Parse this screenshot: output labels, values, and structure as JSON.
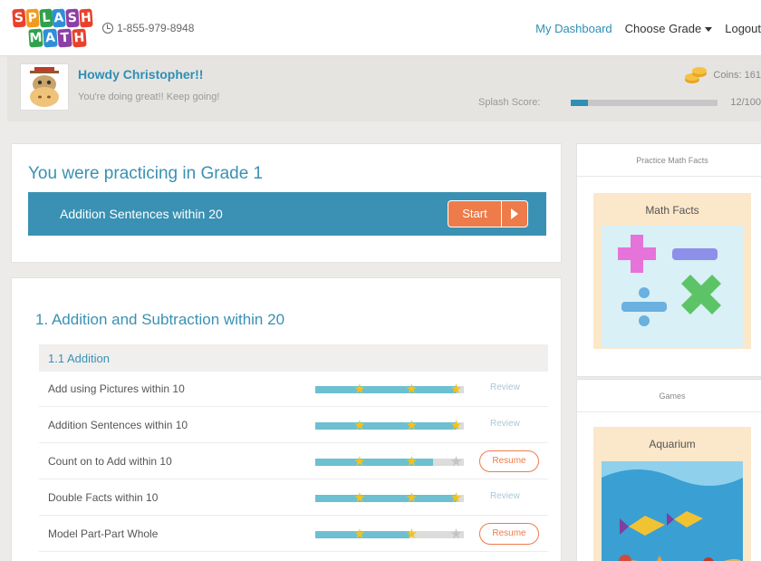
{
  "header": {
    "logo_top": [
      "S",
      "P",
      "L",
      "A",
      "S",
      "H"
    ],
    "logo_bottom": [
      "M",
      "A",
      "T",
      "H"
    ],
    "phone": "1-855-979-8948",
    "nav": {
      "dashboard": "My Dashboard",
      "choose_grade": "Choose Grade",
      "logout": "Logout"
    }
  },
  "greeting": {
    "title": "Howdy Christopher!!",
    "subtitle": "You're doing great!! Keep going!",
    "coins_label": "Coins: 161",
    "score_label": "Splash Score:",
    "score_value": "12/100",
    "score_fraction": 0.12
  },
  "practicing": {
    "title": "You were practicing in Grade 1",
    "skill": "Addition Sentences within 20",
    "start_label": "Start"
  },
  "unit": {
    "title": "1. Addition and Subtraction within 20",
    "subsection": "1.1 Addition",
    "skills": [
      {
        "name": "Add using Pictures within 10",
        "stars": 3,
        "action": "Review"
      },
      {
        "name": "Addition Sentences within 10",
        "stars": 3,
        "action": "Review"
      },
      {
        "name": "Count on to Add within 10",
        "stars": 2.5,
        "action": "Resume"
      },
      {
        "name": "Double Facts within 10",
        "stars": 3,
        "action": "Review"
      },
      {
        "name": "Model Part-Part Whole",
        "stars": 2,
        "action": "Resume"
      }
    ]
  },
  "sidebar": {
    "math_facts_header": "Practice Math Facts",
    "math_facts_tile": "Math Facts",
    "games_header": "Games",
    "games_tile": "Aquarium"
  },
  "colors": {
    "brand_blue": "#3a91b3",
    "accent_orange": "#ee7b4a",
    "progress_teal": "#6cc0d1",
    "star_yellow": "#f4c21b",
    "star_grey": "#c4c4c4"
  }
}
